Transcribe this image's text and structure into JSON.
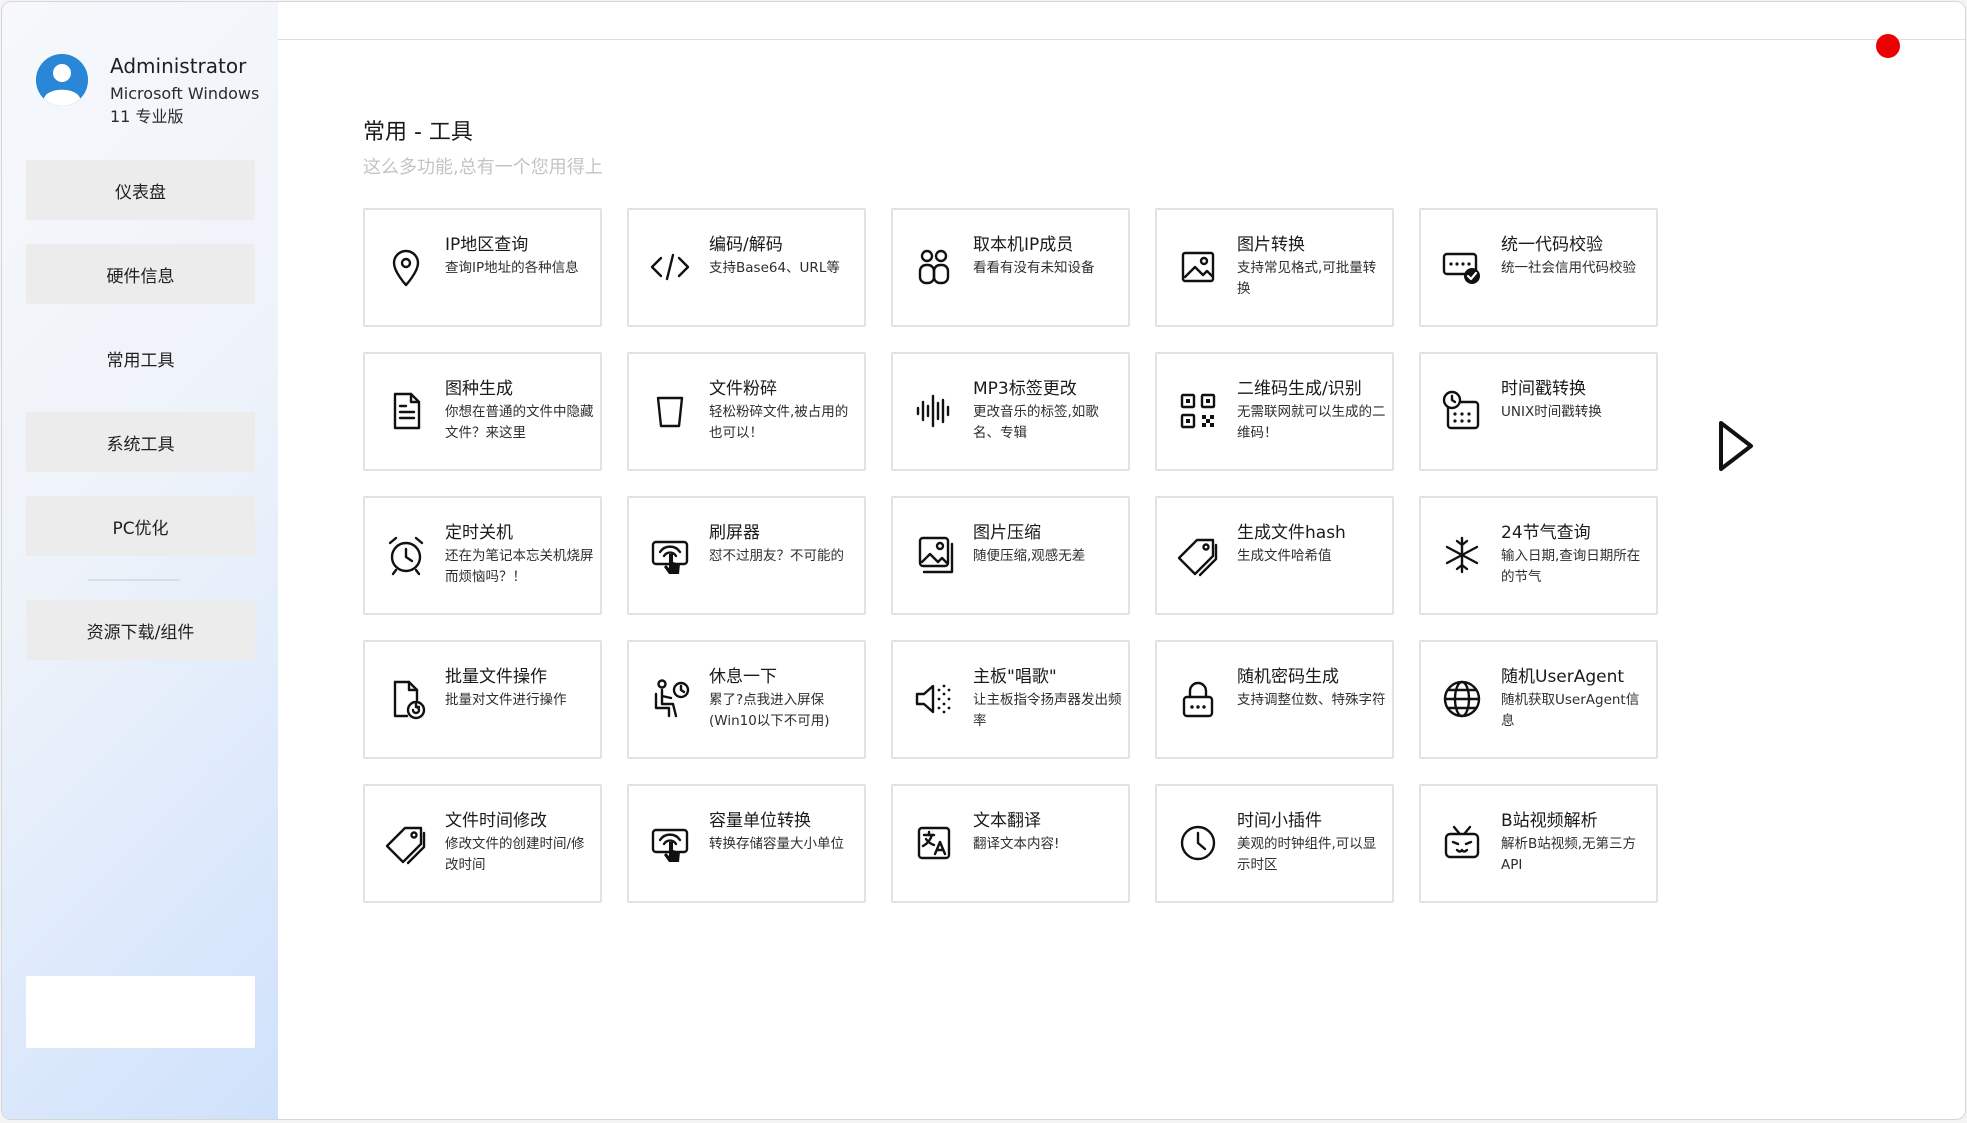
{
  "profile": {
    "name": "Administrator",
    "os": "Microsoft Windows 11 专业版"
  },
  "sidebar": {
    "items": [
      {
        "label": "仪表盘"
      },
      {
        "label": "硬件信息"
      },
      {
        "label": "常用工具"
      },
      {
        "label": "系统工具"
      },
      {
        "label": "PC优化"
      },
      {
        "label": "资源下载/组件"
      }
    ],
    "active": "常用工具"
  },
  "page": {
    "title": "常用 - 工具",
    "subtitle": "这么多功能,总有一个您用得上"
  },
  "tools": [
    {
      "icon": "location-pin-icon",
      "title": "IP地区查询",
      "desc": "查询IP地址的各种信息"
    },
    {
      "icon": "code-icon",
      "title": "编码/解码",
      "desc": "支持Base64、URL等"
    },
    {
      "icon": "people-icon",
      "title": "取本机IP成员",
      "desc": "看看有没有未知设备"
    },
    {
      "icon": "image-icon",
      "title": "图片转换",
      "desc": "支持常见格式,可批量转换"
    },
    {
      "icon": "verify-code-icon",
      "title": "统一代码校验",
      "desc": "统一社会信用代码校验"
    },
    {
      "icon": "document-icon",
      "title": "图种生成",
      "desc": "你想在普通的文件中隐藏文件？来这里"
    },
    {
      "icon": "trash-icon",
      "title": "文件粉碎",
      "desc": "轻松粉碎文件,被占用的也可以！"
    },
    {
      "icon": "audio-wave-icon",
      "title": "MP3标签更改",
      "desc": "更改音乐的标签,如歌名、专辑"
    },
    {
      "icon": "qr-code-icon",
      "title": "二维码生成/识别",
      "desc": "无需联网就可以生成的二维码！"
    },
    {
      "icon": "calendar-clock-icon",
      "title": "时间戳转换",
      "desc": "UNIX时间戳转换"
    },
    {
      "icon": "alarm-clock-icon",
      "title": "定时关机",
      "desc": "还在为笔记本忘关机烧屏而烦恼吗？！"
    },
    {
      "icon": "screen-touch-icon",
      "title": "刷屏器",
      "desc": "怼不过朋友？不可能的"
    },
    {
      "icon": "images-compress-icon",
      "title": "图片压缩",
      "desc": "随便压缩,观感无差"
    },
    {
      "icon": "tag-icon",
      "title": "生成文件hash",
      "desc": "生成文件哈希值"
    },
    {
      "icon": "snowflake-icon",
      "title": "24节气查询",
      "desc": "输入日期,查询日期所在的节气"
    },
    {
      "icon": "file-refresh-icon",
      "title": "批量文件操作",
      "desc": "批量对文件进行操作"
    },
    {
      "icon": "rest-chair-icon",
      "title": "休息一下",
      "desc": "累了?点我进入屏保(Win10以下不可用)"
    },
    {
      "icon": "speaker-icon",
      "title": "主板\"唱歌\"",
      "desc": "让主板指令扬声器发出频率"
    },
    {
      "icon": "lock-icon",
      "title": "随机密码生成",
      "desc": "支持调整位数、特殊字符"
    },
    {
      "icon": "globe-icon",
      "title": "随机UserAgent",
      "desc": "随机获取UserAgent信息"
    },
    {
      "icon": "tag-icon",
      "title": "文件时间修改",
      "desc": "修改文件的创建时间/修改时间"
    },
    {
      "icon": "screen-touch-icon",
      "title": "容量单位转换",
      "desc": "转换存储容量大小单位"
    },
    {
      "icon": "translate-icon",
      "title": "文本翻译",
      "desc": "翻译文本内容!"
    },
    {
      "icon": "clock-icon",
      "title": "时间小插件",
      "desc": "美观的时钟组件,可以显示时区"
    },
    {
      "icon": "bilibili-tv-icon",
      "title": "B站视频解析",
      "desc": "解析B站视频,无第三方API"
    }
  ],
  "colors": {
    "close_dot": "#ee0000",
    "avatar": "#2a86d6",
    "subtitle": "#c4c4c4",
    "card_border": "#e2e2e2"
  }
}
